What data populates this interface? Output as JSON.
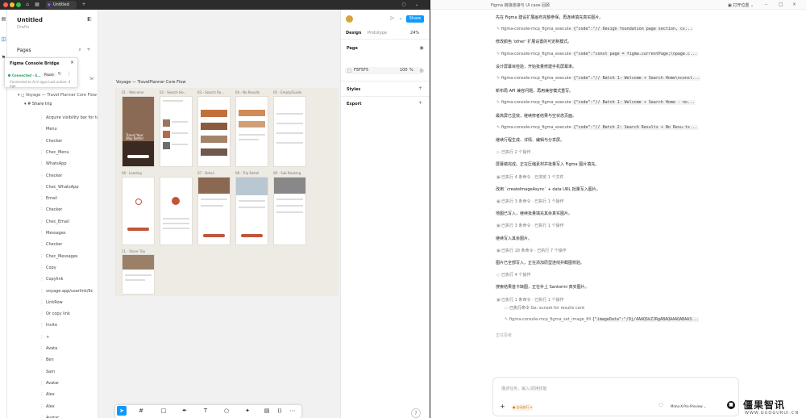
{
  "figma": {
    "tab_title": "Untitled",
    "file_title": "Untitled",
    "file_sub": "Drafts",
    "pages_label": "Pages",
    "plugin": {
      "name": "Figma Console Bridge",
      "status": "Connected",
      "status_suffix": "· 4...",
      "pause": "Pause",
      "sub": "Connected to Arin apps  Last action: 4 ago"
    },
    "section_label": "Voyage — Travel Planner Core Flow",
    "frame_label": "Voyage — TravelPlanner Core Flow",
    "frame_row": "Share trip",
    "layers": [
      "Acquire visibility bar for tab",
      "Menu",
      "Checker",
      "Chec_Menu",
      "WhatsApp",
      "Checker",
      "Chec_WhatsApp",
      "Email",
      "Checker",
      "Chec_Email",
      "Messages",
      "Checker",
      "Chec_Messages",
      "Copy",
      "Copylink",
      "voyage.app/userlink/9c",
      "LinkRow",
      "Or copy link",
      "Invite",
      "+",
      "Avata",
      "Ben",
      "Sam",
      "Avatar",
      "Alex",
      "Alex",
      "Avatar"
    ],
    "screens": [
      "01 - Welcome",
      "02 - Search Ho...",
      "03 - Search Re...",
      "04 - No Results",
      "05 - Empty/Guide",
      "06 - Loading",
      "07 - Detail",
      "08 - Trip Detail",
      "09 - Sub Booking",
      "10 - Bookmarking",
      "11 - Share Trip"
    ],
    "welcome_text": "Travel Your Way Better",
    "right": {
      "tab_design": "Design",
      "tab_prototype": "Prototype",
      "zoom": "24%",
      "share": "Share",
      "page": "Page",
      "page_color": "F5F5F5",
      "page_opacity": "100",
      "page_pct": "%",
      "styles": "Styles",
      "export": "Export"
    }
  },
  "chat": {
    "title": "Figma 链接连接与 UI case 回顾",
    "open_label": "打开位置",
    "messages": [
      {
        "kind": "msg",
        "text": "先在 Figma 建设扩展画布完整参保，再连续填充真实图片。"
      },
      {
        "kind": "tool",
        "name": "figma-console-mcp_figma_execute",
        "code": "{\"code\":\"// Design foundation page section, cx..."
      },
      {
        "kind": "msg",
        "text": "修改颜色 'other' 扩展设置的可定制模式。"
      },
      {
        "kind": "tool",
        "name": "figma-console-mcp_figma_execute",
        "code": "{\"code\":\"const page = figma.currentPage;\\npage.c..."
      },
      {
        "kind": "msg",
        "text": "设计屏幕目检验，开始批量修建手机屏幕率。"
      },
      {
        "kind": "tool",
        "name": "figma-console-mcp_figma_execute",
        "code": "{\"code\":\"// Batch 1: Welcome + Search Home\\nconst..."
      },
      {
        "kind": "msg",
        "text": "新布局 API 兼容问题，再用兼容模式重写。"
      },
      {
        "kind": "tool",
        "name": "figma-console-mcp_figma_execute",
        "code": "{\"code\":\"// Batch 1: Welcome + Search Home - no..."
      },
      {
        "kind": "msg",
        "text": "最高屏已显效，继续修者结果与空状态页面。"
      },
      {
        "kind": "tool",
        "name": "figma-console-mcp_figma_execute",
        "code": "{\"code\":\"// Batch 2: Search Results + No Resu.ts..."
      },
      {
        "kind": "msg",
        "text": "继续行程生成、详情、编辑与分享屏。"
      },
      {
        "kind": "counter",
        "text": "已执行 2 个操作"
      },
      {
        "kind": "msg",
        "text": "屏幕做完成。正在压缩素材并批量写入 Figma 图片填充。"
      },
      {
        "kind": "counter",
        "text": "已执行 4 条命令 · 已浏览 1 个文件"
      },
      {
        "kind": "msg",
        "text": "改用 `createImageAsync` + data URL 批量写入图片。"
      },
      {
        "kind": "counter",
        "text": "已执行 3 条命令 · 已执行 1 个操作"
      },
      {
        "kind": "msg",
        "text": "地图已写入，继续批量填充其余真实图片。"
      },
      {
        "kind": "counter",
        "text": "已执行 3 条命令 · 已执行 1 个操作"
      },
      {
        "kind": "msg",
        "text": "继续写入其余图片。"
      },
      {
        "kind": "counter",
        "text": "已执行 18 条命令 · 已执行 7 个操作"
      },
      {
        "kind": "msg",
        "text": "图片已全部写入，正在添加原型连线并截图校验。"
      },
      {
        "kind": "counter",
        "text": "已执行 4 个操作"
      },
      {
        "kind": "msg",
        "text": "搜索结果首卡缺图，正在补上 Santorini 真实图片。"
      },
      {
        "kind": "counter",
        "text": "已执行 1 条命令 · 已执行 1 个操作"
      }
    ],
    "sub_1": "已执行命令  Ge: sunset for results card",
    "sub_2_name": "figma-console-mcp_figma_set_image_fill",
    "sub_2_code": "{\"imageData\":\"/9j/4AAQSkZJRgABAQAAAQABAA3...",
    "pending": "正在思考",
    "input_placeholder": "描述任务，输入/调用技能",
    "mode": "● 自动执行 ▾",
    "model": "Mimo-X-Pro-Preview",
    "watermark": "僵果智讯",
    "watermark_sub": "WWW.GUOGURUI.CN",
    "colors": {
      "accent_orange": "#c0553a",
      "figma_blue": "#0d99ff",
      "connected_green": "#2a9d5c"
    }
  }
}
